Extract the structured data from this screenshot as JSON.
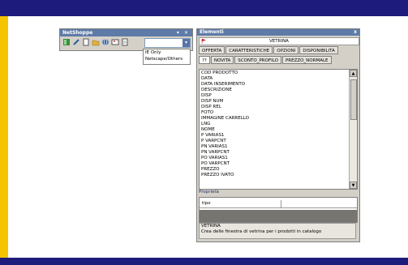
{
  "netshoppe": {
    "title": "NetShoppe",
    "title_buttons": "▾ ✕",
    "tools": [
      "layout-icon",
      "pencil-icon",
      "page-icon",
      "folder-icon",
      "globe-icon",
      "image-icon",
      "document-icon"
    ],
    "dropdown_options": [
      "IE Only",
      "Netscape/Others"
    ]
  },
  "elementi": {
    "title": "Elementi",
    "close_label": "x",
    "header_label": "VETRINA",
    "tabs_row1": [
      "OFFERTA",
      "CARATTERISTICHE",
      "OPZIONI",
      "DISPONIBILITA"
    ],
    "tabs_row2": [
      "??",
      "NOVITA",
      "SCONTO_PROFILO",
      "PREZZO_NORMALE"
    ],
    "items": [
      "COD PRODOTTO",
      "DATA",
      "DATA INSERIMENTO",
      "DESCRIZIONE",
      "DISP",
      "DISP NUM",
      "DISP REL",
      "FOTO",
      "IMMAGINE CARRELLO",
      "LNG",
      "NOME",
      "P VARIAS1",
      "P VARPCNT",
      "PN VARIAS1",
      "PN VARPCNT",
      "PO VARIAS1",
      "PO VARPCNT",
      "PREZZO",
      "PREZZO IVATO"
    ],
    "properties_label": "Proprietà",
    "property_key": "tipo",
    "desc_title": "VETRINA",
    "desc_text": "Crea delle finestra di vetrina per i prodotti in catalogo"
  },
  "colors": {
    "frame": "#f5c400",
    "bars": "#1d1c7c",
    "titlebar": "#5e7ba8"
  }
}
